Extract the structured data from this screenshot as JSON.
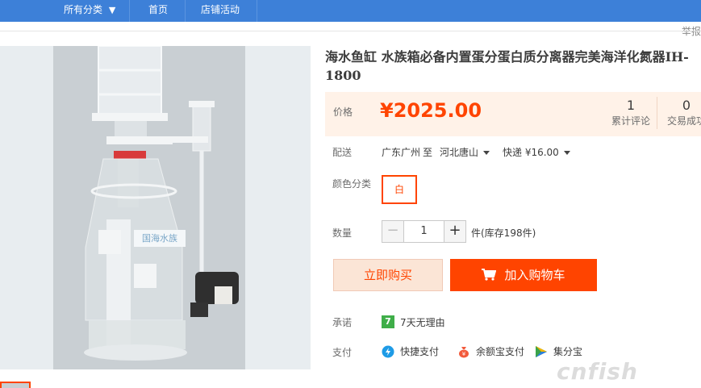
{
  "nav": {
    "all_categories": "所有分类",
    "home": "首页",
    "shop_activity": "店铺活动"
  },
  "report_label": "举报",
  "watermark_text": "国海水族",
  "product": {
    "title": "海水鱼缸 水族箱必备内置蛋分蛋白质分离器完美海洋化氮器IH-1800",
    "price_label": "价格",
    "price": "¥2025.00",
    "reviews_count": "1",
    "reviews_label": "累计评论",
    "deals_count": "0",
    "deals_label": "交易成功"
  },
  "shipping": {
    "label": "配送",
    "from": "广东广州",
    "to_word": "至",
    "to": "河北唐山",
    "method": "快递 ¥16.00"
  },
  "color": {
    "label": "颜色分类",
    "selected": "白"
  },
  "quantity": {
    "label": "数量",
    "value": "1",
    "minus": "−",
    "plus": "+",
    "stock": "件(库存198件)"
  },
  "actions": {
    "buy_now": "立即购买",
    "add_cart": "加入购物车"
  },
  "promise": {
    "label": "承诺",
    "icon_text": "7",
    "text": "7天无理由"
  },
  "payment": {
    "label": "支付",
    "methods": [
      "快捷支付",
      "余额宝支付",
      "集分宝"
    ]
  },
  "site_logo": "cnfish",
  "colors": {
    "nav_bg": "#3d80d8",
    "accent": "#ff4400",
    "price_bg": "#fff2e8",
    "promise_green": "#3fae49"
  }
}
